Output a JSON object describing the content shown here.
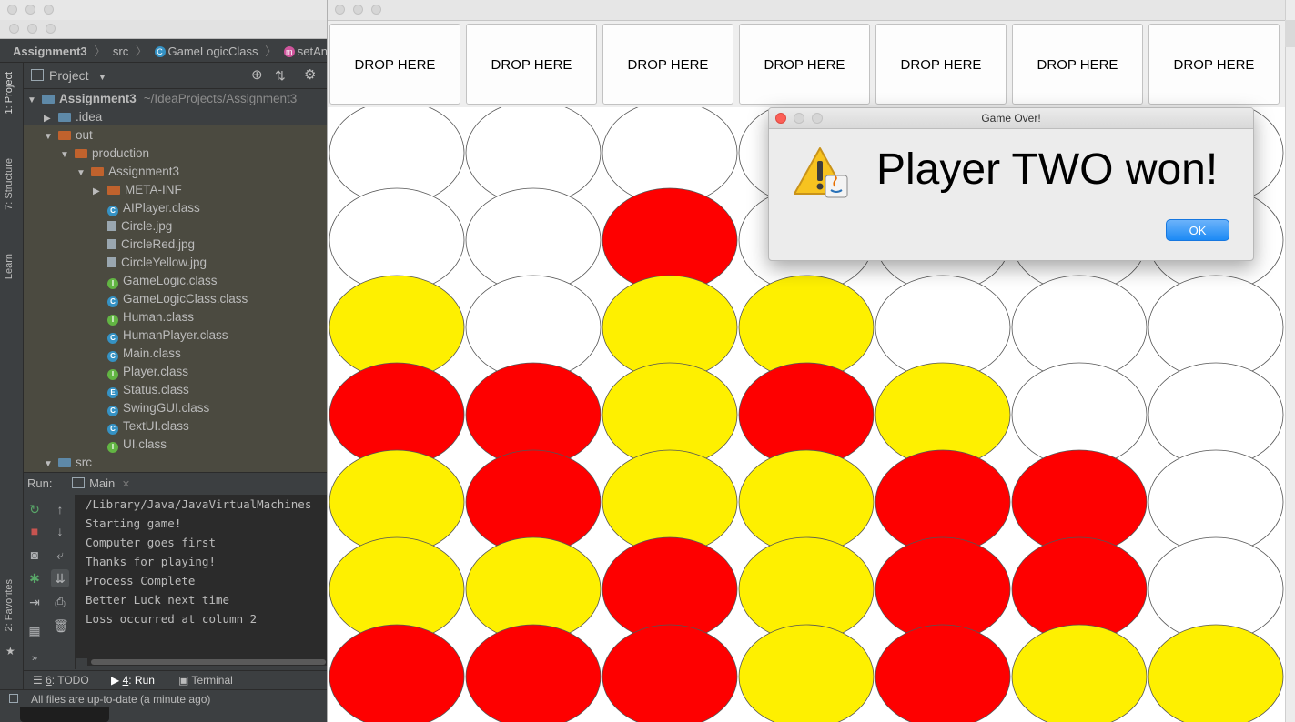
{
  "ide": {
    "breadcrumb": [
      "Assignment3",
      "src",
      "GameLogicClass",
      "setAnswe"
    ],
    "side_tabs": [
      "1: Project",
      "7: Structure",
      "Learn",
      "2: Favorites"
    ],
    "project_panel": {
      "title": "Project"
    },
    "tree": [
      {
        "label": "Assignment3",
        "suffix": "~/IdeaProjects/Assignment3",
        "indent": 0,
        "arrow": "▼",
        "icon": "module"
      },
      {
        "label": ".idea",
        "indent": 1,
        "arrow": "▶",
        "icon": "folder-blue"
      },
      {
        "label": "out",
        "indent": 1,
        "arrow": "▼",
        "icon": "folder-orange"
      },
      {
        "label": "production",
        "indent": 2,
        "arrow": "▼",
        "icon": "folder-orange"
      },
      {
        "label": "Assignment3",
        "indent": 3,
        "arrow": "▼",
        "icon": "folder-orange"
      },
      {
        "label": "META-INF",
        "indent": 4,
        "arrow": "▶",
        "icon": "folder-orange"
      },
      {
        "label": "AIPlayer.class",
        "indent": 4,
        "icon": "class-c"
      },
      {
        "label": "Circle.jpg",
        "indent": 4,
        "icon": "file"
      },
      {
        "label": "CircleRed.jpg",
        "indent": 4,
        "icon": "file"
      },
      {
        "label": "CircleYellow.jpg",
        "indent": 4,
        "icon": "file"
      },
      {
        "label": "GameLogic.class",
        "indent": 4,
        "icon": "class-i"
      },
      {
        "label": "GameLogicClass.class",
        "indent": 4,
        "icon": "class-c"
      },
      {
        "label": "Human.class",
        "indent": 4,
        "icon": "class-i"
      },
      {
        "label": "HumanPlayer.class",
        "indent": 4,
        "icon": "class-c"
      },
      {
        "label": "Main.class",
        "indent": 4,
        "icon": "class-c"
      },
      {
        "label": "Player.class",
        "indent": 4,
        "icon": "class-i"
      },
      {
        "label": "Status.class",
        "indent": 4,
        "icon": "class-e"
      },
      {
        "label": "SwingGUI.class",
        "indent": 4,
        "icon": "class-c"
      },
      {
        "label": "TextUI.class",
        "indent": 4,
        "icon": "class-c"
      },
      {
        "label": "UI.class",
        "indent": 4,
        "icon": "class-i"
      },
      {
        "label": "src",
        "indent": 1,
        "arrow": "▼",
        "icon": "folder-blue"
      }
    ],
    "run": {
      "label": "Run:",
      "tab": "Main",
      "console": [
        "/Library/Java/JavaVirtualMachines",
        "Starting game!",
        "Computer goes first",
        "Thanks for playing!",
        "Process Complete",
        "Better Luck next time",
        "Loss occurred at column 2"
      ]
    },
    "bottom_tabs": [
      {
        "num": "6",
        "label": ": TODO"
      },
      {
        "num": "4",
        "label": ": Run"
      },
      {
        "num": "",
        "label": "Terminal"
      }
    ],
    "status": "All files are up-to-date (a minute ago)",
    "colors": {
      "bg": "#3c3f41",
      "text": "#bbbbbb",
      "console_bg": "#2b2b2b"
    }
  },
  "game": {
    "drop_label": "DROP HERE",
    "columns": 7,
    "board": [
      [
        "empty",
        "empty",
        "empty",
        "empty",
        "empty",
        "empty",
        "empty"
      ],
      [
        "empty",
        "empty",
        "red",
        "empty",
        "empty",
        "empty",
        "empty"
      ],
      [
        "yellow",
        "empty",
        "yellow",
        "yellow",
        "empty",
        "empty",
        "empty"
      ],
      [
        "red",
        "red",
        "yellow",
        "red",
        "yellow",
        "empty",
        "empty"
      ],
      [
        "yellow",
        "red",
        "yellow",
        "yellow",
        "red",
        "red",
        "empty"
      ],
      [
        "yellow",
        "yellow",
        "red",
        "yellow",
        "red",
        "red",
        "empty"
      ],
      [
        "red",
        "red",
        "red",
        "yellow",
        "red",
        "yellow",
        "yellow"
      ]
    ],
    "colors": {
      "red": "#fe0000",
      "yellow": "#fef000",
      "empty": "#ffffff"
    }
  },
  "dialog": {
    "title": "Game Over!",
    "message": "Player TWO won!",
    "ok_label": "OK",
    "icon": "java-warning-icon"
  }
}
